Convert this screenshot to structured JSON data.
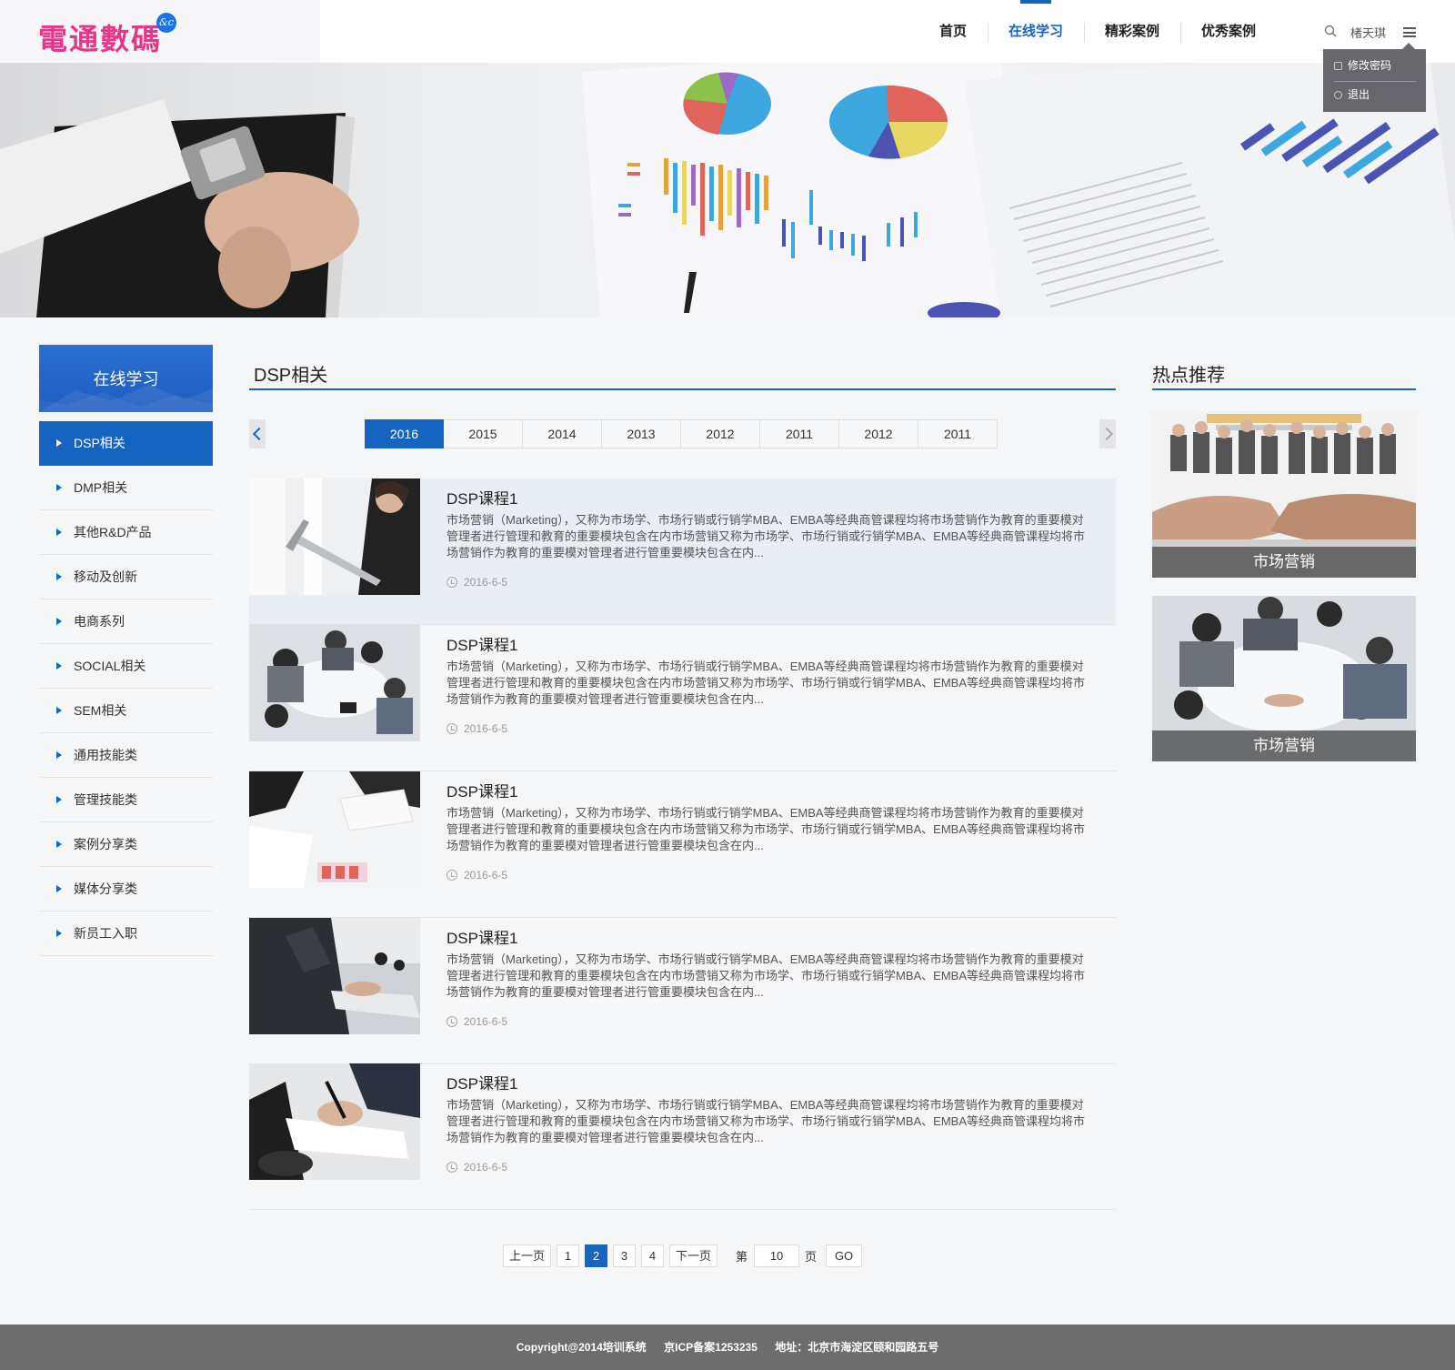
{
  "logo": {
    "text": "電通數碼",
    "badge": "&c"
  },
  "nav": {
    "items": [
      "首页",
      "在线学习",
      "精彩案例",
      "优秀案例"
    ],
    "active_index": 1
  },
  "user": {
    "name": "楮天琪"
  },
  "dropdown": {
    "change_password": "修改密码",
    "logout": "退出"
  },
  "sidebar": {
    "heading": "在线学习",
    "items": [
      "DSP相关",
      "DMP相关",
      "其他R&D产品",
      "移动及创新",
      "电商系列",
      "SOCIAL相关",
      "SEM相关",
      "通用技能类",
      "管理技能类",
      "案例分享类",
      "媒体分享类",
      "新员工入职"
    ],
    "active_index": 0
  },
  "main": {
    "title": "DSP相关",
    "years": [
      "2016",
      "2015",
      "2014",
      "2013",
      "2012",
      "2011",
      "2012",
      "2011"
    ],
    "active_year_index": 0,
    "courses": [
      {
        "title": "DSP课程1",
        "desc": "市场营销（Marketing），又称为市场学、市场行销或行销学MBA、EMBA等经典商管课程均将市场营销作为教育的重要模对管理者进行管理和教育的重要模块包含在内市场营销又称为市场学、市场行销或行销学MBA、EMBA等经典商管课程均将市场营销作为教育的重要模对管理者进行管重要模块包含在内...",
        "date": "2016-6-5"
      },
      {
        "title": "DSP课程1",
        "desc": "市场营销（Marketing），又称为市场学、市场行销或行销学MBA、EMBA等经典商管课程均将市场营销作为教育的重要模对管理者进行管理和教育的重要模块包含在内市场营销又称为市场学、市场行销或行销学MBA、EMBA等经典商管课程均将市场营销作为教育的重要模对管理者进行管重要模块包含在内...",
        "date": "2016-6-5"
      },
      {
        "title": "DSP课程1",
        "desc": "市场营销（Marketing），又称为市场学、市场行销或行销学MBA、EMBA等经典商管课程均将市场营销作为教育的重要模对管理者进行管理和教育的重要模块包含在内市场营销又称为市场学、市场行销或行销学MBA、EMBA等经典商管课程均将市场营销作为教育的重要模对管理者进行管重要模块包含在内...",
        "date": "2016-6-5"
      },
      {
        "title": "DSP课程1",
        "desc": "市场营销（Marketing），又称为市场学、市场行销或行销学MBA、EMBA等经典商管课程均将市场营销作为教育的重要模对管理者进行管理和教育的重要模块包含在内市场营销又称为市场学、市场行销或行销学MBA、EMBA等经典商管课程均将市场营销作为教育的重要模对管理者进行管重要模块包含在内...",
        "date": "2016-6-5"
      },
      {
        "title": "DSP课程1",
        "desc": "市场营销（Marketing），又称为市场学、市场行销或行销学MBA、EMBA等经典商管课程均将市场营销作为教育的重要模对管理者进行管理和教育的重要模块包含在内市场营销又称为市场学、市场行销或行销学MBA、EMBA等经典商管课程均将市场营销作为教育的重要模对管理者进行管重要模块包含在内...",
        "date": "2016-6-5"
      }
    ]
  },
  "pagination": {
    "prev": "上一页",
    "pages": [
      "1",
      "2",
      "3",
      "4"
    ],
    "active_page": "2",
    "next": "下一页",
    "label_before": "第",
    "input_value": "10",
    "label_after": "页",
    "go": "GO"
  },
  "hot": {
    "title": "热点推荐",
    "cards": [
      {
        "caption": "市场营销"
      },
      {
        "caption": "市场营销"
      }
    ]
  },
  "footer": {
    "copyright": "Copyright@2014培训系统",
    "icp": "京ICP备案1253235",
    "address": "地址：北京市海淀区颐和园路五号"
  },
  "colors": {
    "accent": "#1565c0",
    "logo": "#e8358a",
    "footer_bg": "#6d6d6d"
  }
}
